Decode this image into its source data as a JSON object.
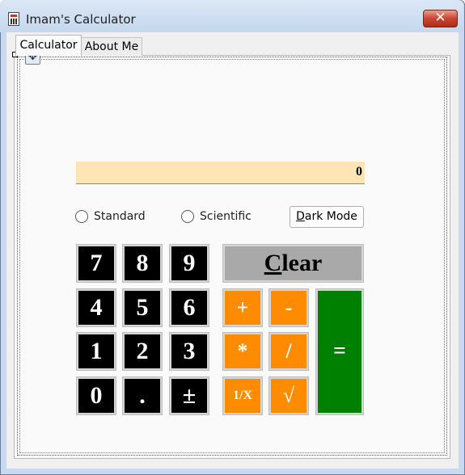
{
  "window": {
    "title": "Imam's Calculator",
    "close_glyph": "✕",
    "icon": "calculator-icon"
  },
  "tabs": [
    {
      "label": "Calculator",
      "selected": true
    },
    {
      "label": "About Me",
      "selected": false
    }
  ],
  "designer": {
    "move_glyph": "✥"
  },
  "display": {
    "value": "0",
    "background": "#ffe4b5"
  },
  "mode_options": [
    {
      "label": "Standard",
      "selected": false
    },
    {
      "label": "Scientific",
      "selected": false
    }
  ],
  "dark_mode_button": {
    "mnemonic": "D",
    "rest": "ark Mode"
  },
  "clear_button": {
    "mnemonic": "C",
    "rest": "lear",
    "background": "#a9a9a9"
  },
  "digits": {
    "seven": "7",
    "eight": "8",
    "nine": "9",
    "four": "4",
    "five": "5",
    "six": "6",
    "one": "1",
    "two": "2",
    "three": "3",
    "zero": "0",
    "decimal": ".",
    "sign": "±"
  },
  "operators": {
    "add": "+",
    "subtract": "-",
    "multiply": "*",
    "divide": "/",
    "reciprocal": "1/X",
    "sqrt": "√",
    "equals": "="
  },
  "colors": {
    "digit_keys": "#000000",
    "operator_keys": "#ff8c00",
    "equals_key": "#008000"
  }
}
